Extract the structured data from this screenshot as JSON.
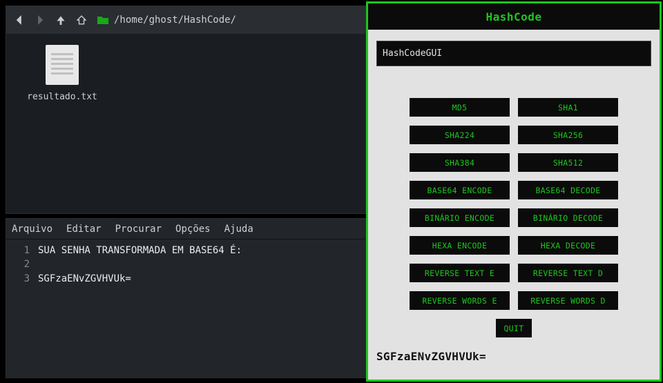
{
  "file_manager": {
    "path": "/home/ghost/HashCode/",
    "file": {
      "name": "resultado.txt"
    }
  },
  "editor": {
    "menu": [
      "Arquivo",
      "Editar",
      "Procurar",
      "Opções",
      "Ajuda"
    ],
    "lines": [
      {
        "n": "1",
        "t": "SUA SENHA TRANSFORMADA EM BASE64 É:"
      },
      {
        "n": "2",
        "t": ""
      },
      {
        "n": "3",
        "t": "SGFzaENvZGVHVUk="
      }
    ]
  },
  "hashcode": {
    "title": "HashCode",
    "input_value": "HashCodeGUI",
    "buttons": {
      "md5": "MD5",
      "sha1": "SHA1",
      "sha224": "SHA224",
      "sha256": "SHA256",
      "sha384": "SHA384",
      "sha512": "SHA512",
      "b64e": "BASE64 ENCODE",
      "b64d": "BASE64 DECODE",
      "bine": "BINÁRIO ENCODE",
      "bind": "BINÁRIO DECODE",
      "hexe": "HEXA ENCODE",
      "hexd": "HEXA DECODE",
      "rte": "REVERSE TEXT E",
      "rtd": "REVERSE TEXT D",
      "rwe": "REVERSE WORDS E",
      "rwd": "REVERSE WORDS D",
      "quit": "QUIT"
    },
    "result": "SGFzaENvZGVHVUk="
  }
}
